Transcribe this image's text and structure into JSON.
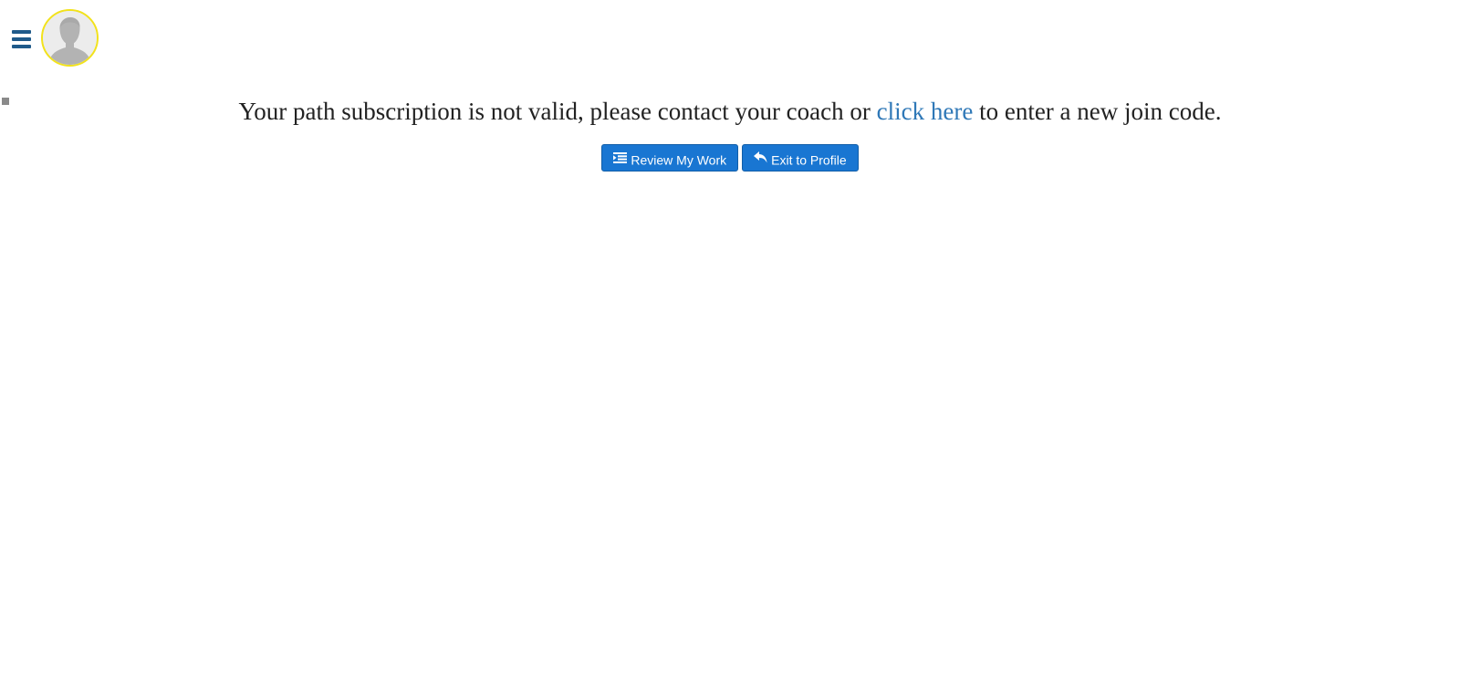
{
  "header": {
    "menu_icon": "hamburger-menu-icon",
    "avatar_icon": "user-silhouette-icon",
    "avatar_border_color": "#f2e21c"
  },
  "notice": {
    "text_before": "Your path subscription is not valid, please contact your coach or ",
    "link_text": "click here",
    "text_after": " to enter a new join code."
  },
  "actions": {
    "review_label": "Review My Work",
    "review_icon": "indent-list-icon",
    "exit_label": "Exit to Profile",
    "exit_icon": "reply-arrow-icon",
    "button_color": "#1976d2"
  },
  "colors": {
    "link": "#2f78b7",
    "menu": "#1f5a8a"
  }
}
